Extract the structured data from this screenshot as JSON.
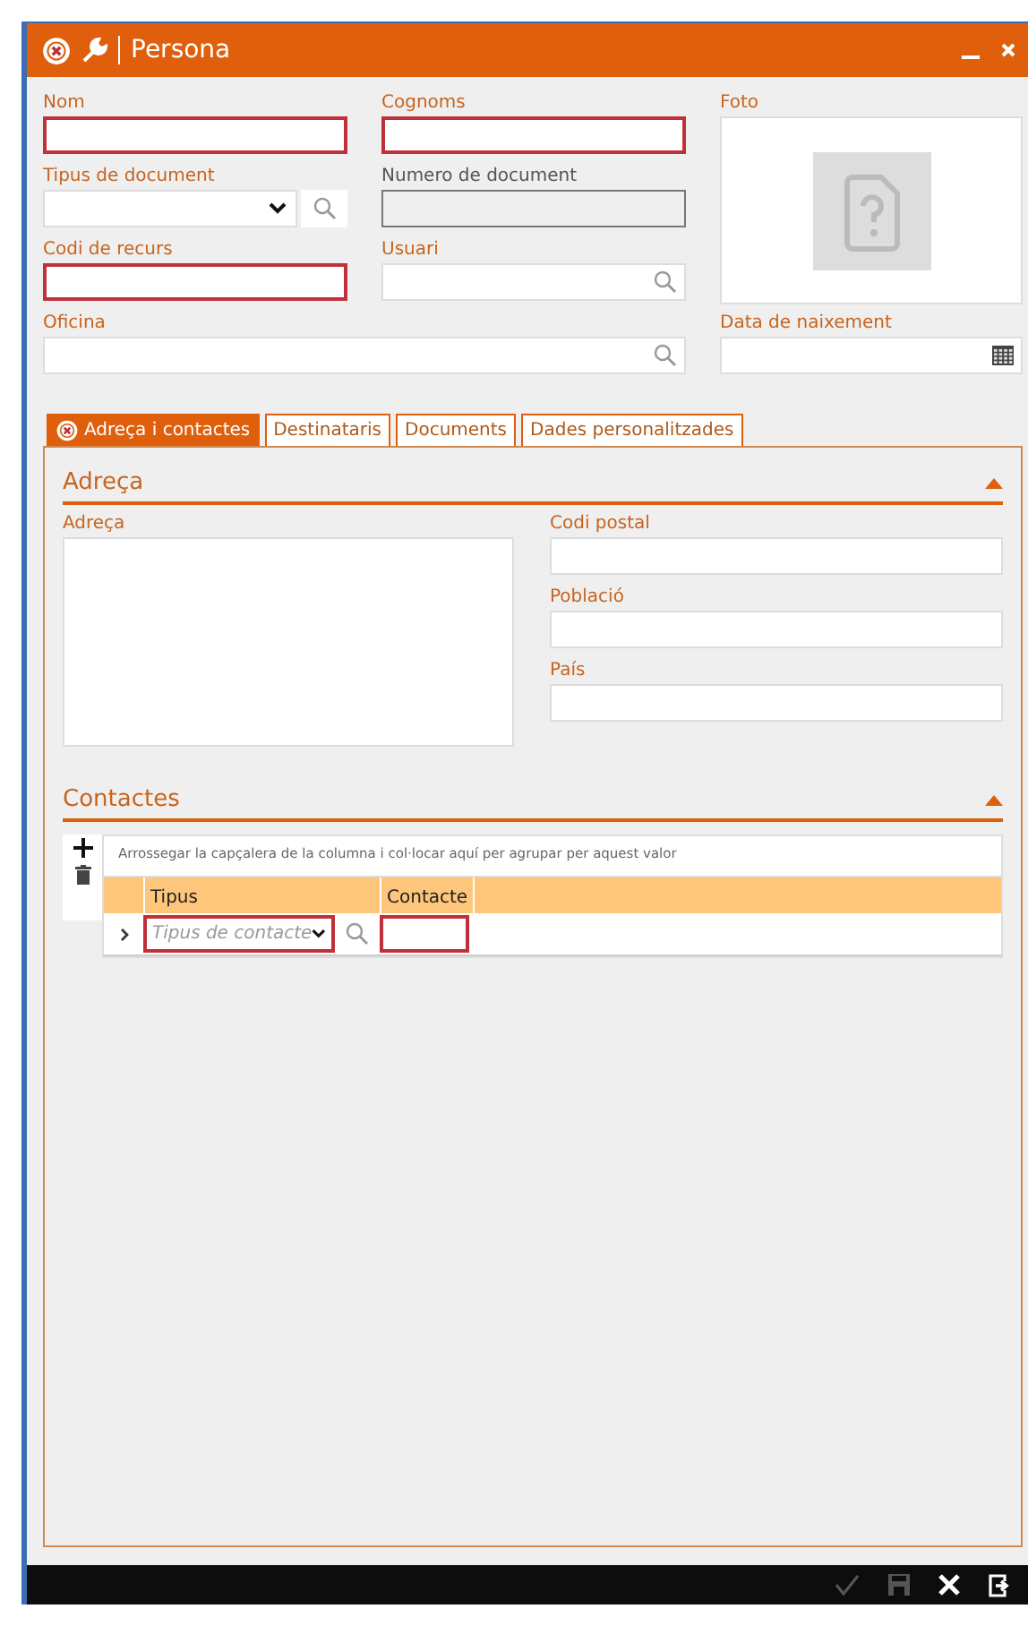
{
  "window": {
    "title": "Persona",
    "has_error": true
  },
  "fields": [
    {
      "label": "Nom",
      "kind": "text",
      "required": true
    },
    {
      "label": "Cognoms",
      "kind": "text",
      "required": true
    },
    {
      "label": "Foto",
      "kind": "photo"
    },
    {
      "label": "Tipus de document",
      "kind": "select",
      "required": false
    },
    {
      "label": "Numero de document",
      "kind": "readonly",
      "required": false
    },
    {
      "label": "Codi de recurs",
      "kind": "text",
      "required": true
    },
    {
      "label": "Usuari",
      "kind": "lookup",
      "required": false
    },
    {
      "label": "Oficina",
      "kind": "lookup",
      "required": false
    },
    {
      "label": "Data de naixement",
      "kind": "date",
      "required": false
    }
  ],
  "tabs": [
    {
      "label": "Adreça i contactes",
      "selected": true,
      "has_error": true
    },
    {
      "label": "Destinataris",
      "selected": false,
      "has_error": false
    },
    {
      "label": "Documents",
      "selected": false,
      "has_error": false
    },
    {
      "label": "Dades personalitzades",
      "selected": false,
      "has_error": false
    }
  ],
  "address_section": {
    "title": "Adreça",
    "expanded": true,
    "address_label": "Adreça",
    "fields": [
      {
        "label": "Codi postal"
      },
      {
        "label": "Població"
      },
      {
        "label": "País"
      }
    ]
  },
  "contacts_section": {
    "title": "Contactes",
    "expanded": true,
    "group_hint": "Arrossegar la capçalera de la columna i col·locar aquí per agrupar per aquest valor",
    "columns": [
      "Tipus",
      "Contacte"
    ],
    "new_row": {
      "type_placeholder": "Tipus de contacte",
      "required": true
    }
  },
  "footer": {
    "buttons": [
      {
        "kind": "accept",
        "disabled": true
      },
      {
        "kind": "save",
        "disabled": true
      },
      {
        "kind": "cancel",
        "disabled": false
      },
      {
        "kind": "exit",
        "disabled": false
      }
    ]
  }
}
